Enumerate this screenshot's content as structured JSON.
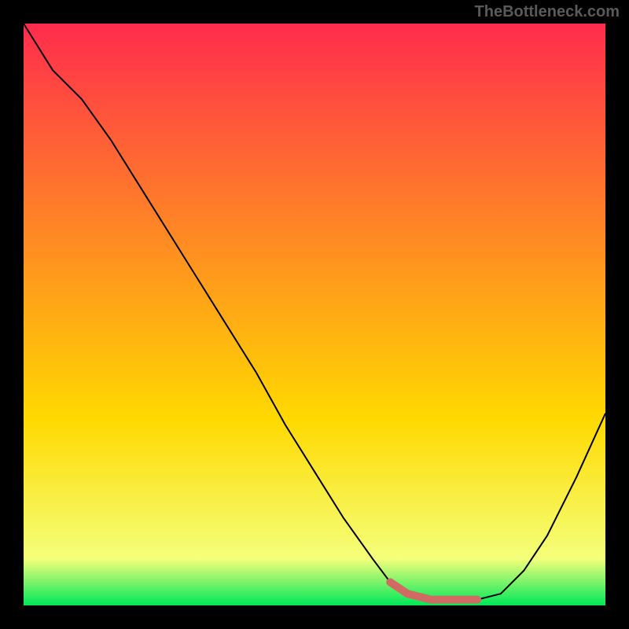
{
  "watermark": "TheBottleneck.com",
  "chart_data": {
    "type": "line",
    "title": "",
    "xlabel": "",
    "ylabel": "",
    "xlim": [
      0,
      100
    ],
    "ylim": [
      0,
      100
    ],
    "background_gradient": {
      "top": "#ff2c4d",
      "mid": "#ffd900",
      "bottom": "#00e85a"
    },
    "green_band_top_y": 95,
    "green_band_bottom_y": 100,
    "curve": {
      "x": [
        0,
        5,
        10,
        15,
        20,
        25,
        30,
        35,
        40,
        45,
        50,
        55,
        60,
        63,
        66,
        70,
        74,
        78,
        82,
        86,
        90,
        95,
        100
      ],
      "y": [
        0,
        8,
        13,
        20,
        28,
        36,
        44,
        52,
        60,
        69,
        77,
        85,
        92,
        96,
        98,
        99,
        99,
        99,
        98,
        94,
        88,
        78,
        67
      ]
    },
    "highlight_segment": {
      "color": "#d16a63",
      "x": [
        63,
        66,
        70,
        74,
        78
      ],
      "y": [
        96,
        98,
        99,
        99,
        99
      ]
    }
  }
}
